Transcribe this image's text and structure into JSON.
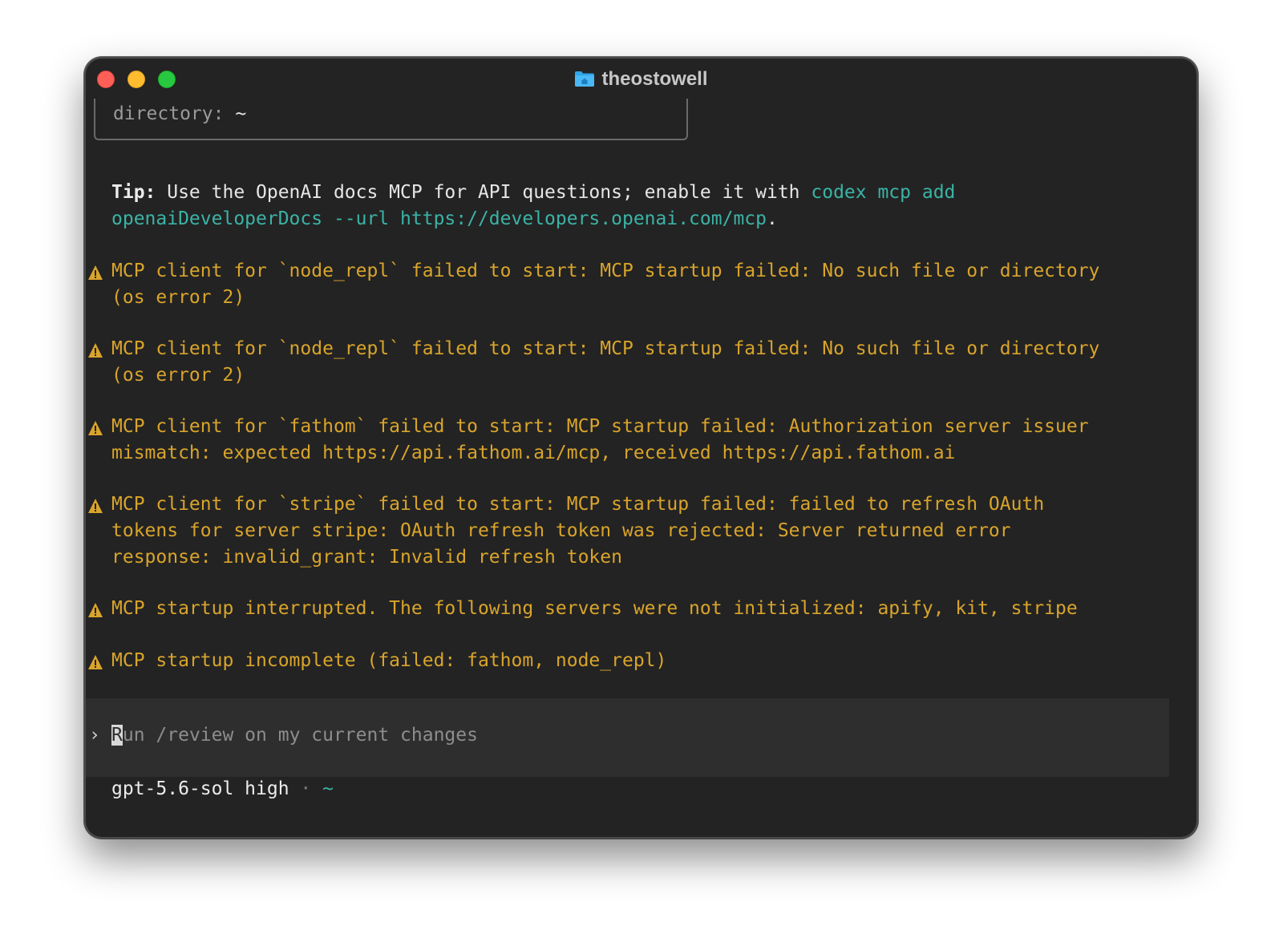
{
  "window": {
    "title": "theostowell",
    "title_icon": "folder-icon"
  },
  "session_box": {
    "directory_label": "directory:",
    "directory_value": "~"
  },
  "tip": {
    "label": "Tip:",
    "text": " Use the OpenAI docs MCP for API questions; enable it with ",
    "command_part1": "codex mcp add",
    "command_part2": "openaiDeveloperDocs --url https://developers.openai.com/mcp",
    "end": "."
  },
  "warnings": [
    {
      "lines": [
        "MCP client for `node_repl` failed to start: MCP startup failed: No such file or directory",
        "(os error 2)"
      ]
    },
    {
      "lines": [
        "MCP client for `node_repl` failed to start: MCP startup failed: No such file or directory",
        "(os error 2)"
      ]
    },
    {
      "lines": [
        "MCP client for `fathom` failed to start: MCP startup failed: Authorization server issuer",
        "mismatch: expected https://api.fathom.ai/mcp, received https://api.fathom.ai"
      ]
    },
    {
      "lines": [
        "MCP client for `stripe` failed to start: MCP startup failed: failed to refresh OAuth",
        "tokens for server stripe: OAuth refresh token was rejected: Server returned error",
        "response: invalid_grant: Invalid refresh token"
      ]
    },
    {
      "lines": [
        "MCP startup interrupted. The following servers were not initialized: apify, kit, stripe"
      ]
    },
    {
      "lines": [
        "MCP startup incomplete (failed: fathom, node_repl)"
      ]
    }
  ],
  "prompt": {
    "chevron": "›",
    "placeholder_first": "R",
    "placeholder_rest": "un /review on my current changes"
  },
  "status": {
    "model": "gpt-5.6-sol high",
    "separator": "·",
    "directory": "~"
  },
  "colors": {
    "background": "#232323",
    "warning": "#d9a42b",
    "accent": "#3bb3a6"
  }
}
